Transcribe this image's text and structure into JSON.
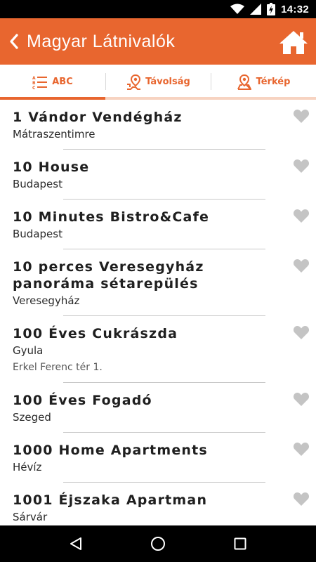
{
  "status_bar": {
    "time": "14:32"
  },
  "app_bar": {
    "title": "Magyar Látnivalók"
  },
  "colors": {
    "accent": "#e8662f",
    "accent_light": "#f7d3c1",
    "heart": "#c4c4c4"
  },
  "tabs": [
    {
      "label": "ABC",
      "icon": "abc-list-icon",
      "selected": true
    },
    {
      "label": "Távolság",
      "icon": "distance-pin-icon",
      "selected": false
    },
    {
      "label": "Térkép",
      "icon": "map-pin-icon",
      "selected": false
    }
  ],
  "items": [
    {
      "title": "1 Vándor Vendégház",
      "city": "Mátraszentimre"
    },
    {
      "title": "10 House",
      "city": "Budapest"
    },
    {
      "title": "10 Minutes Bistro&Cafe",
      "city": "Budapest"
    },
    {
      "title": "10 perces Veresegyház panoráma sétarepülés",
      "city": "Veresegyház"
    },
    {
      "title": "100 Éves Cukrászda",
      "city": "Gyula",
      "address": "Erkel Ferenc tér 1."
    },
    {
      "title": "100 Éves Fogadó",
      "city": "Szeged"
    },
    {
      "title": "1000 Home Apartments",
      "city": "Hévíz"
    },
    {
      "title": "1001 Éjszaka Apartman",
      "city": "Sárvár"
    }
  ]
}
